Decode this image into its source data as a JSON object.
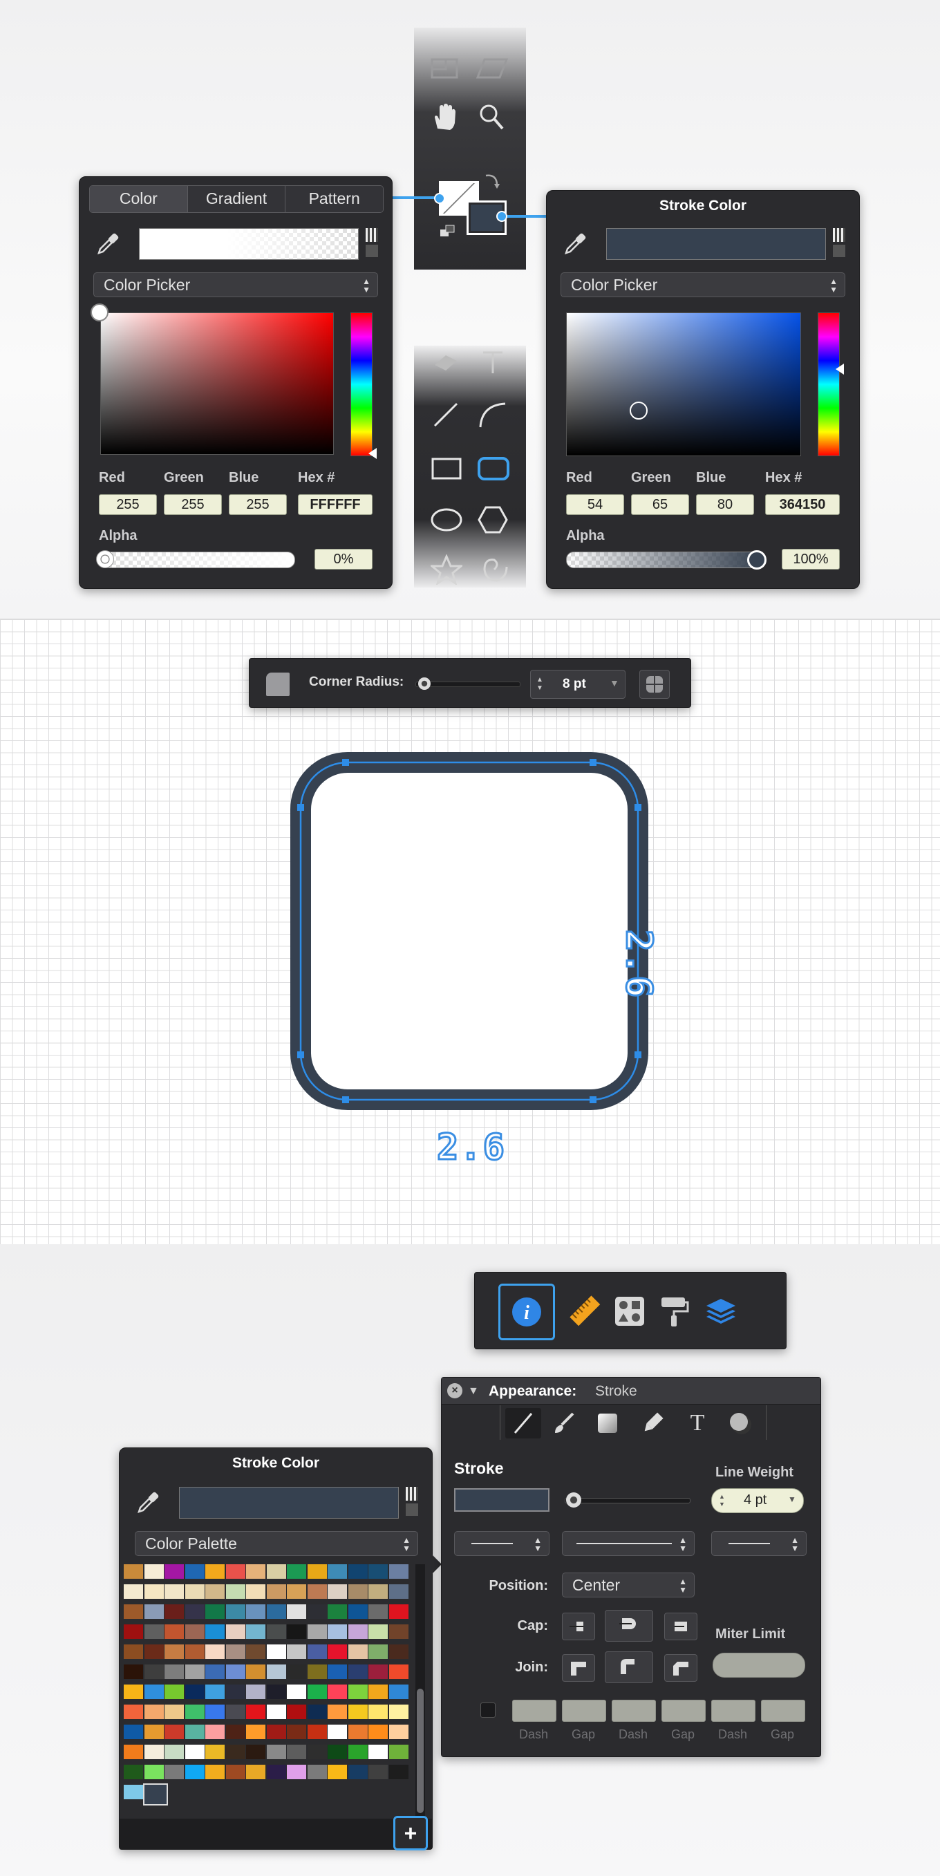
{
  "colors": {
    "stroke": "#364150",
    "accent": "#3ea2ee",
    "panel": "#2b2b2e",
    "field": "#eef0d8"
  },
  "fill_panel": {
    "tabs": [
      "Color",
      "Gradient",
      "Pattern"
    ],
    "mode_label": "Color Picker",
    "labels": {
      "red": "Red",
      "green": "Green",
      "blue": "Blue",
      "hex": "Hex #",
      "alpha": "Alpha"
    },
    "values": {
      "red": "255",
      "green": "255",
      "blue": "255",
      "hex": "FFFFFF",
      "alpha": "0%"
    }
  },
  "stroke_panel": {
    "title": "Stroke Color",
    "mode_label": "Color Picker",
    "labels": {
      "red": "Red",
      "green": "Green",
      "blue": "Blue",
      "hex": "Hex #",
      "alpha": "Alpha"
    },
    "values": {
      "red": "54",
      "green": "65",
      "blue": "80",
      "hex": "364150",
      "alpha": "100%"
    }
  },
  "toolbox": {
    "tools_top": [
      "rectangle-select-icon",
      "parallelogram-icon",
      "hand-icon",
      "zoom-icon"
    ],
    "tools_bottom": [
      "eraser-icon",
      "text-tool-icon",
      "line-icon",
      "curve-icon",
      "rectangle-icon",
      "rounded-rectangle-icon",
      "ellipse-icon",
      "polygon-icon",
      "star-icon",
      "spiral-icon"
    ]
  },
  "corner_bar": {
    "label": "Corner Radius:",
    "value": "8 pt",
    "radius_level": 0.05
  },
  "canvas": {
    "width_label": "2.6",
    "height_label": "2.6"
  },
  "inspector_tabs": [
    "info-icon",
    "ruler-icon",
    "shapes-icon",
    "paint-roller-icon",
    "layers-icon"
  ],
  "palette_panel": {
    "title": "Stroke Color",
    "mode_label": "Color Palette",
    "add_label": "+",
    "swatches": [
      [
        "#c98a3a",
        "#f6ecd6",
        "#a417a4",
        "#1f67b3",
        "#f2a81c",
        "#e9524b",
        "#e5b27a",
        "#d9cfa4",
        "#1b9a53",
        "#e8a817",
        "#3e8bb6",
        "#114470",
        "#184e74",
        "#6b7fa2"
      ],
      [
        "#f4ead0",
        "#f5e6c2",
        "#f1e5c8",
        "#eadbb4",
        "#d2b88a",
        "#c5dcb1",
        "#f2ddb7",
        "#cc9a63",
        "#d7a157",
        "#bd7a53",
        "#ddd0c4",
        "#a78b68",
        "#c2ae7f",
        "#5e6f88"
      ],
      [
        "#9d5a2a",
        "#8a9bb6",
        "#6a1f1a",
        "#35334a",
        "#127848",
        "#3c8aa6",
        "#6992bd",
        "#2b6b9e",
        "#e1e1e1",
        "#2d2e34",
        "#1b823e",
        "#0e5596",
        "#6b6b6b",
        "#e0141f"
      ],
      [
        "#9e1010",
        "#5f5f5f",
        "#c2552f",
        "#9c6654",
        "#1a8fd6",
        "#e8cfc0",
        "#73b5cf",
        "#4a4d4d",
        "#171717",
        "#a8a8a8",
        "#a7bfe0",
        "#c7a6d8",
        "#c9e0a9",
        "#71432a"
      ],
      [
        "#8c4d21",
        "#6b2b19",
        "#c67c43",
        "#b15c31",
        "#f7d9c5",
        "#a88f83",
        "#704a2f",
        "#ffffff",
        "#c6c6c6",
        "#4a5ea3",
        "#e6132c",
        "#e4c4a4",
        "#7fae6a",
        "#4a2a1e"
      ],
      [
        "#2b1308",
        "#3e3e3e",
        "#7d7d7d",
        "#a2a2a2",
        "#3b6bb5",
        "#6d8ed4",
        "#d38f2f",
        "#b5c6d5",
        "#2a2a2a",
        "#7e6e1e",
        "#1a60b3",
        "#2a3e70",
        "#9c1f3c",
        "#f04a2b"
      ],
      [
        "#f7b417",
        "#2f8fdd",
        "#77c92e",
        "#0a2a5c",
        "#3fa0e0",
        "#2c2f3f",
        "#b2b2c8",
        "#1e1e2a",
        "#ffffff",
        "#1bb14b",
        "#ff4258",
        "#7dd23d",
        "#f1a71c",
        "#2f87d6"
      ],
      [
        "#f2643b",
        "#f4a86c",
        "#eec889",
        "#3fc06a",
        "#3878ec",
        "#4a4a52",
        "#e3151b",
        "#ffffff",
        "#b10e10",
        "#0f2c52",
        "#ff9a3d",
        "#f4c91f",
        "#ffe66d",
        "#fff1a1"
      ],
      [
        "#0f5aa6",
        "#e69a2f",
        "#cc3a2a",
        "#59b3a1",
        "#fc9fa0",
        "#4e2216",
        "#ff9c2a",
        "#a11b16",
        "#7a2b16",
        "#c73013",
        "#ffffff",
        "#ea7a2f",
        "#ff8c1a",
        "#ffcf9e"
      ],
      [
        "#f17c1b",
        "#f5eddc",
        "#c8dcc4",
        "#ffffff",
        "#eab926",
        "#3a2a1e",
        "#2b1a11",
        "#898989",
        "#5d5d5d",
        "#2e2e2e",
        "#0e4a17",
        "#2aa42b",
        "#ffffff",
        "#6fb23a"
      ],
      [
        "#1f5a1b",
        "#7ae35f",
        "#7a7a7a",
        "#10a8f4",
        "#f2ad1e",
        "#9e4a22",
        "#e8a826",
        "#2b1d48",
        "#e0a0ea",
        "#7b7b7b",
        "#f9b817",
        "#173c63",
        "#404040",
        "#1d1d1d"
      ],
      [
        "#7ec9e9",
        "#364150"
      ]
    ]
  },
  "appearance_panel": {
    "title_prefix": "Appearance:",
    "title_value": "Stroke",
    "tool_icons": [
      "stroke-tool-icon",
      "brush-icon",
      "fill-gradient-icon",
      "pen-nib-icon",
      "text-icon",
      "shadow-icon"
    ],
    "stroke_label": "Stroke",
    "line_weight_label": "Line Weight",
    "line_weight_value": "4 pt",
    "line_weight_level": 0.05,
    "position_label": "Position:",
    "position_value": "Center",
    "cap_label": "Cap:",
    "join_label": "Join:",
    "miter_label": "Miter Limit",
    "dash_labels": [
      "Dash",
      "Gap",
      "Dash",
      "Gap",
      "Dash",
      "Gap"
    ]
  }
}
